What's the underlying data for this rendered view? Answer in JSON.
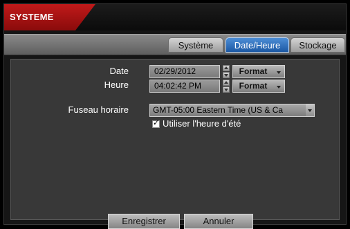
{
  "window": {
    "title": "SYSTEME"
  },
  "tabs": [
    {
      "label": "Système",
      "active": false
    },
    {
      "label": "Date/Heure",
      "active": true
    },
    {
      "label": "Stockage",
      "active": false
    }
  ],
  "form": {
    "date_label": "Date",
    "date_value": "02/29/2012",
    "time_label": "Heure",
    "time_value": "04:02:42 PM",
    "format_label": "Format",
    "timezone_label": "Fuseau horaire",
    "timezone_value": "GMT-05:00  Eastern Time (US & Ca",
    "dst_label": "Utiliser l'heure d'été",
    "dst_checked": true
  },
  "footer": {
    "save_label": "Enregistrer",
    "cancel_label": "Annuler"
  },
  "colors": {
    "title_accent": "#b01414",
    "active_tab": "#2f6fbf"
  }
}
